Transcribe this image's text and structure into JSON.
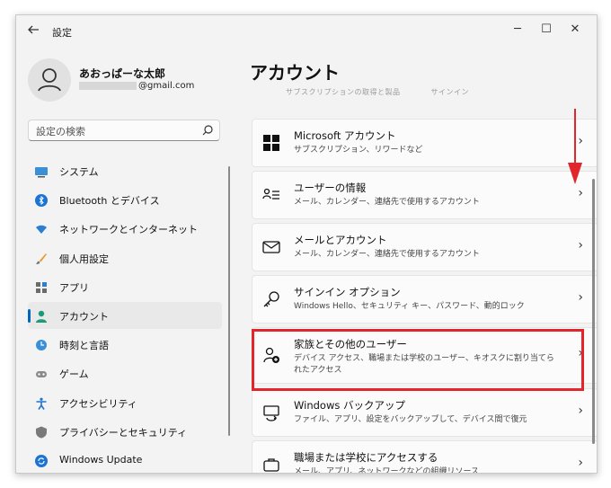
{
  "window": {
    "title": "設定",
    "back_icon": "arrow-left-icon",
    "minimize": "─",
    "maximize": "☐",
    "close": "✕"
  },
  "profile": {
    "name": "あおっぱーな太郎",
    "email_suffix": "@gmail.com"
  },
  "search": {
    "placeholder": "設定の検索"
  },
  "nav": {
    "items": [
      {
        "label": "システム",
        "icon": "monitor-icon"
      },
      {
        "label": "Bluetooth とデバイス",
        "icon": "bluetooth-icon"
      },
      {
        "label": "ネットワークとインターネット",
        "icon": "wifi-icon"
      },
      {
        "label": "個人用設定",
        "icon": "brush-icon"
      },
      {
        "label": "アプリ",
        "icon": "apps-icon"
      },
      {
        "label": "アカウント",
        "icon": "person-icon",
        "selected": true
      },
      {
        "label": "時刻と言語",
        "icon": "globe-clock-icon"
      },
      {
        "label": "ゲーム",
        "icon": "gamepad-icon"
      },
      {
        "label": "アクセシビリティ",
        "icon": "accessibility-icon"
      },
      {
        "label": "プライバシーとセキュリティ",
        "icon": "shield-icon"
      },
      {
        "label": "Windows Update",
        "icon": "update-icon"
      }
    ]
  },
  "main": {
    "page_title": "アカウント",
    "faded_top": "サブスクリプションの取得と製品　　　　サインイン",
    "cards": [
      {
        "title": "Microsoft アカウント",
        "subtitle": "サブスクリプション、リワードなど",
        "icon": "windows-logo-icon"
      },
      {
        "title": "ユーザーの情報",
        "subtitle": "メール、カレンダー、連絡先で使用するアカウント",
        "icon": "user-info-icon"
      },
      {
        "title": "メールとアカウント",
        "subtitle": "メール、カレンダー、連絡先で使用するアカウント",
        "icon": "mail-icon"
      },
      {
        "title": "サインイン オプション",
        "subtitle": "Windows Hello、セキュリティ キー、パスワード、動的ロック",
        "icon": "key-icon"
      },
      {
        "title": "家族とその他のユーザー",
        "subtitle": "デバイス アクセス、職場または学校のユーザー、キオスクに割り当てられたアクセス",
        "icon": "add-user-icon"
      },
      {
        "title": "Windows バックアップ",
        "subtitle": "ファイル、アプリ、設定をバックアップして、デバイス間で復元",
        "icon": "backup-icon"
      },
      {
        "title": "職場または学校にアクセスする",
        "subtitle": "メール、アプリ、ネットワークなどの組織リソース",
        "icon": "briefcase-icon"
      }
    ]
  },
  "colors": {
    "accent": "#0067c0",
    "highlight": "#e3242b",
    "window_bg": "#f3f3f3",
    "card_bg": "#fbfbfb"
  }
}
